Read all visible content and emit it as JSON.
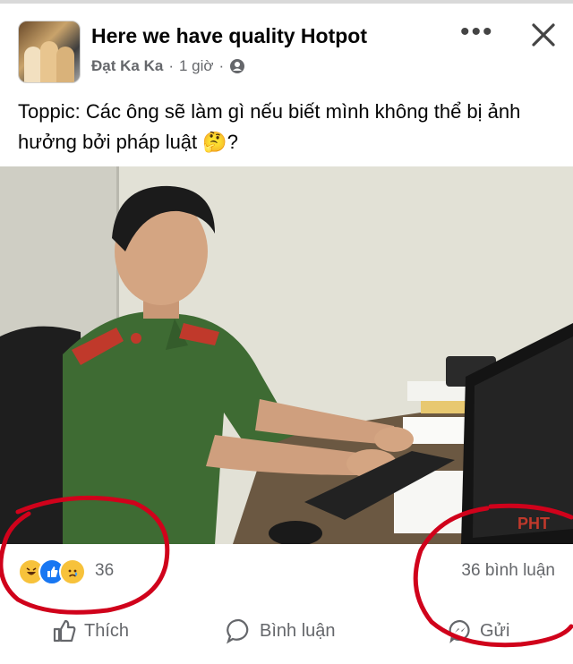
{
  "post": {
    "group_name": "Here we have quality Hotpot",
    "author": "Đạt Ka Ka",
    "separator": "·",
    "time": "1 giờ",
    "more_icon": "more-horizontal-icon",
    "close_icon": "close-icon",
    "privacy_icon": "group-members-icon",
    "text": "Toppic: Các ông sẽ làm gì nếu biết mình không thể bị ảnh hưởng bởi pháp luật",
    "emoji": "🤔",
    "text_end": "?",
    "photo_watermark": "PHT"
  },
  "stats": {
    "reaction_icons": [
      "haha-icon",
      "like-icon",
      "sad-icon"
    ],
    "reaction_count": "36",
    "comment_count": "36 bình luận"
  },
  "actions": {
    "like": "Thích",
    "comment": "Bình luận",
    "send": "Gửi"
  },
  "colors": {
    "secondary_text": "#65676b",
    "like_blue": "#1877f2",
    "annotation_red": "#d0021b"
  }
}
